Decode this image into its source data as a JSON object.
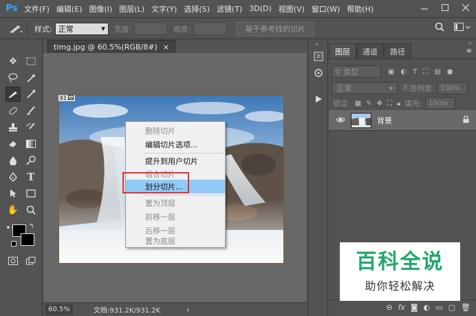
{
  "app": {
    "logo": "Ps",
    "accent": "#31a8ff"
  },
  "menubar": {
    "items": [
      "文件(F)",
      "编辑(E)",
      "图像(I)",
      "图层(L)",
      "文字(Y)",
      "选择(S)",
      "滤镜(T)",
      "3D(D)",
      "视图(V)",
      "窗口(W)",
      "帮助(H)"
    ],
    "window_controls": [
      "minimize-icon",
      "maximize-icon",
      "close-icon"
    ]
  },
  "options": {
    "style_label": "样式:",
    "style_value": "正常",
    "width_label": "宽度:",
    "height_label": "高度:",
    "slice_button": "基于参考线的切片"
  },
  "document": {
    "tab_title": "timg.jpg @ 60.5%(RGB/8#)",
    "slice_number": "01",
    "zoom": "60.5%",
    "doc_info": "文档:931.2K/931.2K",
    "doc_arrow": "›"
  },
  "context_menu": {
    "items": [
      {
        "label": "删除切片",
        "enabled": false
      },
      {
        "label": "编辑切片选项...",
        "enabled": true
      },
      {
        "label": "提升到用户切片",
        "enabled": true
      },
      {
        "label": "组合切片",
        "enabled": false
      },
      {
        "label": "划分切片...",
        "enabled": true,
        "highlighted": true
      },
      {
        "label": "置为顶层",
        "enabled": false
      },
      {
        "label": "前移一层",
        "enabled": false
      },
      {
        "label": "后移一层",
        "enabled": false
      },
      {
        "label": "置为底层",
        "enabled": false
      }
    ],
    "highlight_color": "#91c9f7",
    "callout_color": "#e03030"
  },
  "layers_panel": {
    "tabs": [
      "图层",
      "通道",
      "路径"
    ],
    "filter_placeholder": "类型",
    "blend_mode": "正常",
    "opacity_label": "不透明度:",
    "opacity_value": "100%",
    "lock_label": "锁定:",
    "fill_label": "填充:",
    "fill_value": "100%",
    "layer_name": "背景"
  },
  "watermark": {
    "title": "百科全说",
    "subtitle": "助你轻松解决",
    "color": "#21a86a"
  }
}
